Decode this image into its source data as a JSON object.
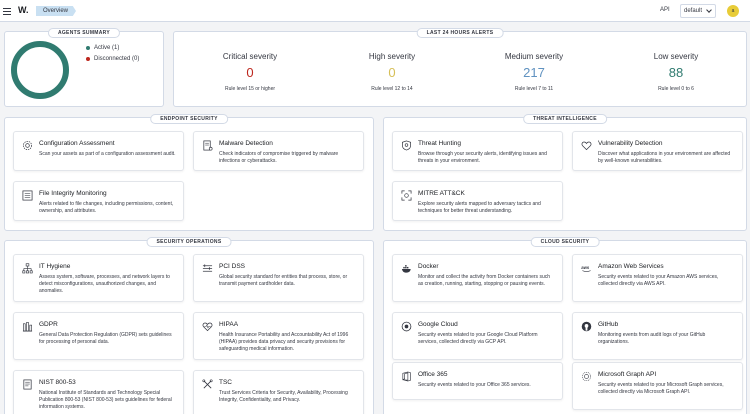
{
  "header": {
    "logo": "W.",
    "breadcrumb": "Overview",
    "api_label": "API",
    "tenant": "default",
    "avatar_initial": "a"
  },
  "agents_summary": {
    "title": "AGENTS SUMMARY",
    "active_label": "Active (1)",
    "disconnected_label": "Disconnected (0)",
    "active_color": "#307b70",
    "disconnected_color": "#bd271e"
  },
  "alerts": {
    "title": "LAST 24 HOURS ALERTS",
    "items": [
      {
        "label": "Critical severity",
        "value": "0",
        "rule": "Rule level 15 or higher",
        "color": "#bd271e"
      },
      {
        "label": "High severity",
        "value": "0",
        "rule": "Rule level 12 to 14",
        "color": "#d6bf57"
      },
      {
        "label": "Medium severity",
        "value": "217",
        "rule": "Rule level 7 to 11",
        "color": "#6092c0"
      },
      {
        "label": "Low severity",
        "value": "88",
        "rule": "Rule level 0 to 6",
        "color": "#307b70"
      }
    ]
  },
  "endpoint_security": {
    "title": "ENDPOINT SECURITY",
    "cards": [
      {
        "title": "Configuration Assessment",
        "desc": "Scan your assets as part of a configuration assessment audit."
      },
      {
        "title": "Malware Detection",
        "desc": "Check indicators of compromise triggered by malware infections or cyberattacks."
      },
      {
        "title": "File Integrity Monitoring",
        "desc": "Alerts related to file changes, including permissions, content, ownership, and attributes."
      }
    ]
  },
  "threat_intelligence": {
    "title": "THREAT INTELLIGENCE",
    "cards": [
      {
        "title": "Threat Hunting",
        "desc": "Browse through your security alerts, identifying issues and threats in your environment."
      },
      {
        "title": "Vulnerability Detection",
        "desc": "Discover what applications in your environment are affected by well-known vulnerabilities."
      },
      {
        "title": "MITRE ATT&CK",
        "desc": "Explore security alerts mapped to adversary tactics and techniques for better threat understanding."
      }
    ]
  },
  "security_operations": {
    "title": "SECURITY OPERATIONS",
    "cards": [
      {
        "title": "IT Hygiene",
        "desc": "Assess system, software, processes, and network layers to detect misconfigurations, unauthorized changes, and anomalies."
      },
      {
        "title": "PCI DSS",
        "desc": "Global security standard for entities that process, store, or transmit payment cardholder data."
      },
      {
        "title": "GDPR",
        "desc": "General Data Protection Regulation (GDPR) sets guidelines for processing of personal data."
      },
      {
        "title": "HIPAA",
        "desc": "Health Insurance Portability and Accountability Act of 1996 (HIPAA) provides data privacy and security provisions for safeguarding medical information."
      },
      {
        "title": "NIST 800-53",
        "desc": "National Institute of Standards and Technology Special Publication 800-53 (NIST 800-53) sets guidelines for federal information systems."
      },
      {
        "title": "TSC",
        "desc": "Trust Services Criteria for Security, Availability, Processing Integrity, Confidentiality, and Privacy."
      }
    ]
  },
  "cloud_security": {
    "title": "CLOUD SECURITY",
    "cards": [
      {
        "title": "Docker",
        "desc": "Monitor and collect the activity from Docker containers such as creation, running, starting, stopping or pausing events."
      },
      {
        "title": "Amazon Web Services",
        "desc": "Security events related to your Amazon AWS services, collected directly via AWS API."
      },
      {
        "title": "Google Cloud",
        "desc": "Security events related to your Google Cloud Platform services, collected directly via GCP API."
      },
      {
        "title": "GitHub",
        "desc": "Monitoring events from audit logs of your GitHub organizations."
      },
      {
        "title": "Office 365",
        "desc": "Security events related to your Office 365 services."
      },
      {
        "title": "Microsoft Graph API",
        "desc": "Security events related to your Microsoft Graph services, collected directly via Microsoft Graph API."
      }
    ]
  }
}
